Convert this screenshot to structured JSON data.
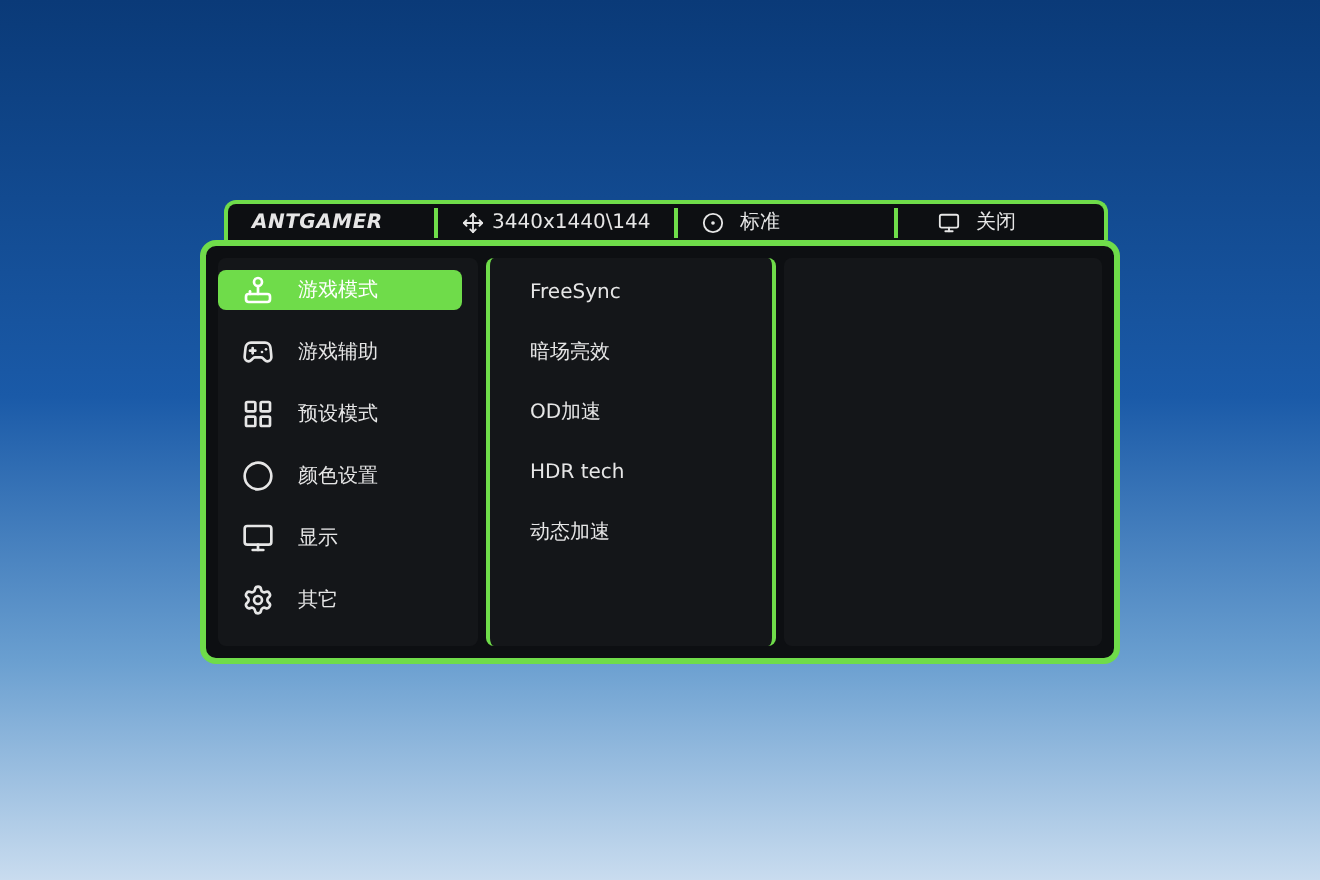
{
  "header": {
    "logo": "ANTGAMER",
    "resolution": "3440x1440\\144",
    "mode": "标准",
    "setting": "关闭"
  },
  "menu": [
    {
      "label": "游戏模式",
      "selected": true
    },
    {
      "label": "游戏辅助",
      "selected": false
    },
    {
      "label": "预设模式",
      "selected": false
    },
    {
      "label": "颜色设置",
      "selected": false
    },
    {
      "label": "显示",
      "selected": false
    },
    {
      "label": "其它",
      "selected": false
    }
  ],
  "submenu": [
    "FreeSync",
    "暗场亮效",
    "OD加速",
    "HDR tech",
    "动态加速"
  ]
}
